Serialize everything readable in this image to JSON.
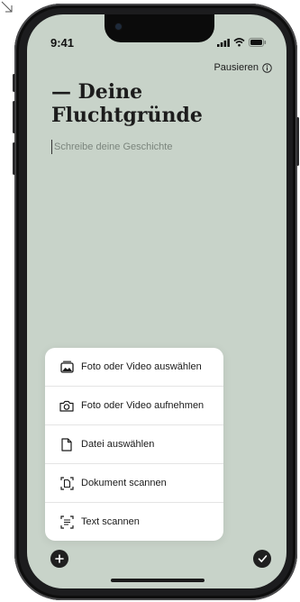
{
  "status_bar": {
    "time": "9:41",
    "icons": [
      "signal-icon",
      "wifi-icon",
      "battery-icon"
    ]
  },
  "header": {
    "pause_label": "Pausieren",
    "pause_icon": "info-icon"
  },
  "main": {
    "title": "— Deine Fluchtgründe",
    "story_placeholder": "Schreibe deine Geschichte"
  },
  "menu": {
    "items": [
      {
        "label": "Foto oder Video auswählen",
        "icon": "photo-library-icon"
      },
      {
        "label": "Foto oder Video aufnehmen",
        "icon": "camera-icon"
      },
      {
        "label": "Datei auswählen",
        "icon": "document-icon"
      },
      {
        "label": "Dokument scannen",
        "icon": "document-scan-icon"
      },
      {
        "label": "Text scannen",
        "icon": "text-scan-icon"
      }
    ]
  },
  "bottom_bar": {
    "add_icon": "plus-icon",
    "done_icon": "checkmark-icon"
  },
  "colors": {
    "screen_background": "#c8d3c9",
    "phone_frame": "#1c1c1e",
    "menu_background": "#ffffff",
    "text": "#1a1a1a"
  }
}
